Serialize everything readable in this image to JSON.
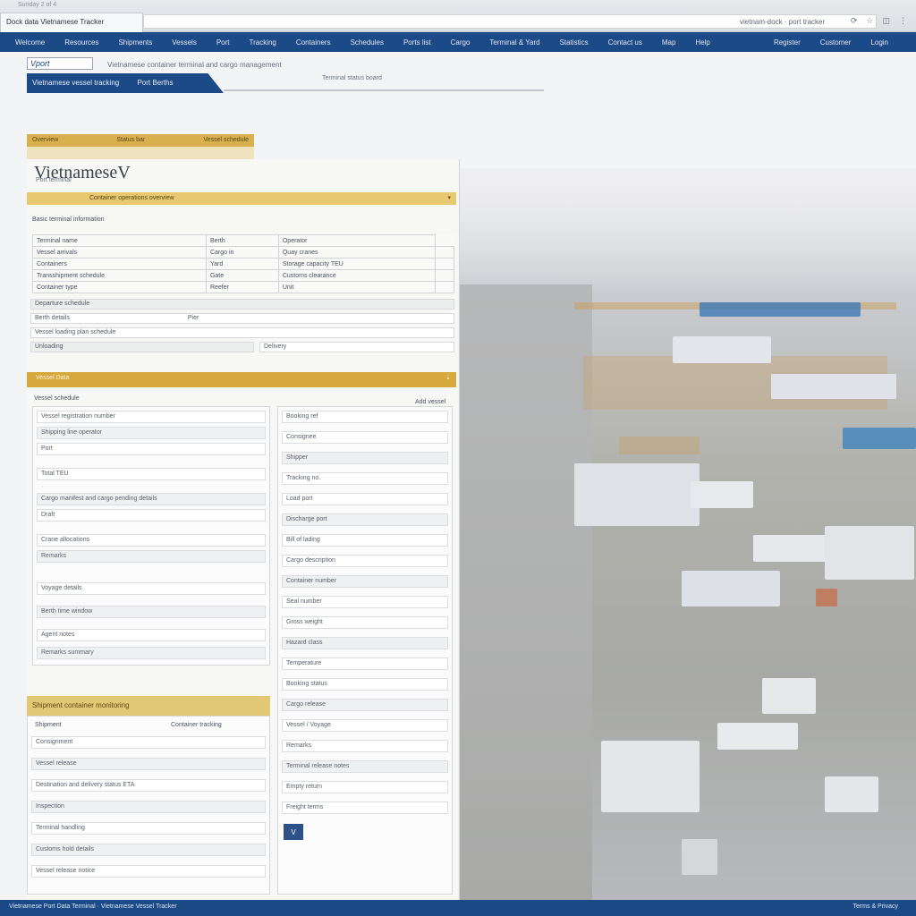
{
  "browser": {
    "top_status": "Sunday 2 of 4",
    "tab_title": "Dock data Vietnamese Tracker",
    "address": "vietnam-dock · port tracker",
    "icons": [
      "refresh-icon",
      "star-icon",
      "extension-icon",
      "settings-icon"
    ]
  },
  "navbar": {
    "items": [
      "Welcome",
      "Resources",
      "Shipments",
      "Vessels",
      "Port",
      "Tracking",
      "Containers",
      "Schedules",
      "Ports list",
      "Cargo",
      "Terminal & Yard",
      "Statistics",
      "Contact us",
      "Map",
      "Help"
    ],
    "right_items": [
      "Register",
      "Customer",
      "Login"
    ]
  },
  "header": {
    "logo_text": "Vport",
    "tagline": "Vietnamese container terminal and cargo management",
    "subnav_left": "Vietnamese vessel tracking",
    "subnav_right": "Port Berths",
    "subnav_link": "Terminal status board"
  },
  "gold_strip": {
    "left": "Overview",
    "middle": "Status bar",
    "right": "Vessel schedule"
  },
  "panel": {
    "title": "VietnameseV",
    "subtitle": "Port terminal",
    "section1": {
      "label": "Container operations overview",
      "caret": "▾"
    },
    "general_label": "Basic terminal information",
    "table": [
      [
        "Terminal name",
        "Berth",
        "Operator"
      ],
      [
        "Vessel arrivals",
        "Cargo in",
        "Quay cranes",
        ""
      ],
      [
        "Containers",
        "Yard",
        "Storage capacity TEU",
        ""
      ],
      [
        "Transshipment schedule",
        "Gate",
        "Customs clearance",
        ""
      ],
      [
        "Container type",
        "Reefer",
        "Unit",
        ""
      ]
    ],
    "row_fields": {
      "a_label": "Departure schedule",
      "a_value": "Berth details",
      "a_extra": "Pier",
      "b_label": "Vessel loading plan schedule",
      "c_label": "Unloading",
      "c_value": "Delivery"
    },
    "section2": {
      "label": "Vessel Data",
      "caret": "⇣"
    },
    "vessel_label": "Vessel schedule",
    "vessel_right": "Add vessel",
    "left_col": [
      "Vessel registration number",
      "Shipping line operator",
      "Port",
      "Total TEU",
      "Cargo manifest and cargo pending details",
      "Draft",
      "Crane allocations",
      "Remarks"
    ],
    "left_col2": [
      "Voyage details",
      "Berth time window",
      "Agent notes",
      "Remarks summary"
    ],
    "right_col": [
      "Booking ref",
      "Consignee",
      "Shipper",
      "Tracking no.",
      "Load port",
      "Discharge port",
      "Bill of lading",
      "Cargo description",
      "Container number",
      "Seal number",
      "Gross weight",
      "Hazard class",
      "Temperature",
      "Booking status",
      "Cargo release",
      "Vessel / Voyage",
      "Remarks",
      "Terminal release notes",
      "Empty return",
      "Freight terms"
    ],
    "card": {
      "header": "Shipment container monitoring",
      "tab1": "Shipment",
      "tab2": "Container tracking",
      "fields": [
        "Consignment",
        "Vessel release",
        "Destination and delivery status ETA",
        "Inspection",
        "Terminal handling",
        "Customs hold details",
        "Vessel release notice"
      ]
    },
    "badge": "V"
  },
  "footer": {
    "left": "Vietnamese Port Data Terminal · Vietnamese Vessel Tracker",
    "right": "Terms & Privacy"
  }
}
